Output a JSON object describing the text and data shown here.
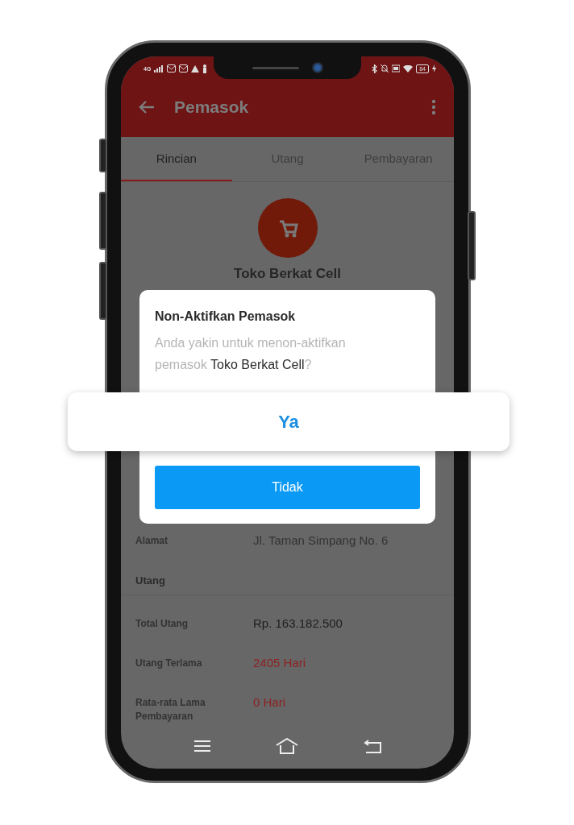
{
  "status_bar": {
    "network": "4G",
    "battery": "84"
  },
  "app_bar": {
    "title": "Pemasok"
  },
  "tabs": [
    {
      "label": "Rincian",
      "selected": true
    },
    {
      "label": "Utang",
      "selected": false
    },
    {
      "label": "Pembayaran",
      "selected": false
    }
  ],
  "supplier": {
    "name": "Toko Berkat Cell"
  },
  "address": {
    "label": "Alamat",
    "value": "Jl. Taman Simpang No. 6"
  },
  "debt_section": {
    "title": "Utang",
    "rows": [
      {
        "label": "Total Utang",
        "value": "Rp. 163.182.500",
        "kind": "amount"
      },
      {
        "label": "Utang Terlama",
        "value": "2405 Hari",
        "kind": "alert"
      },
      {
        "label": "Rata-rata Lama Pembayaran",
        "value": "0 Hari",
        "kind": "alert"
      }
    ]
  },
  "dialog": {
    "title": "Non-Aktifkan Pemasok",
    "message": "Anda yakin untuk menon-aktifkan pemasok **Toko Berkat Cell**?",
    "buttons": [
      {
        "label": "Ya",
        "kind": "highlighted"
      },
      {
        "label": "Tidak",
        "kind": "primary"
      }
    ]
  }
}
